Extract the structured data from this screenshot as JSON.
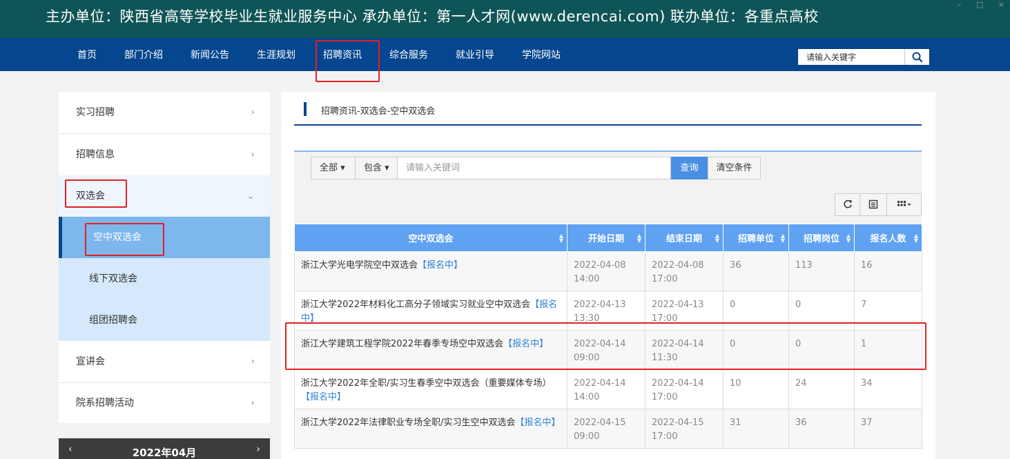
{
  "banner": {
    "text": "主办单位：陕西省高等学校毕业生就业服务中心   承办单位：第一人才网(www.derencai.com)   联办单位：各重点高校"
  },
  "window_controls": {
    "minimize": "–",
    "restore": "□",
    "close": "×"
  },
  "nav": {
    "items": [
      "首页",
      "部门介绍",
      "新闻公告",
      "生涯规划",
      "招聘资讯",
      "综合服务",
      "就业引导",
      "学院网站"
    ],
    "search_placeholder": "请输入关键字"
  },
  "sidebar": {
    "items": [
      {
        "label": "实习招聘",
        "arrow": "›"
      },
      {
        "label": "招聘信息",
        "arrow": "›"
      },
      {
        "label": "双选会",
        "arrow": "⌄"
      },
      {
        "label": "宣讲会",
        "arrow": "›"
      },
      {
        "label": "院系招聘活动",
        "arrow": "›"
      }
    ],
    "sub_items": [
      "空中双选会",
      "线下双选会",
      "组团招聘会"
    ]
  },
  "calendar": {
    "title": "2022年04月",
    "prev": "‹",
    "next": "›"
  },
  "content": {
    "breadcrumb": "招聘资讯-双选会-空中双选会",
    "filter": {
      "scope": "全部",
      "mode": "包含",
      "keyword_placeholder": "请输入关键词",
      "query_label": "查询",
      "clear_label": "清空条件"
    },
    "table": {
      "headers": [
        "空中双选会",
        "开始日期",
        "结束日期",
        "招聘单位",
        "招聘岗位",
        "报名人数"
      ],
      "status_label": "【报名中】",
      "rows": [
        {
          "name": "浙江大学光电学院空中双选会",
          "start": "2022-04-08 14:00",
          "end": "2022-04-08 17:00",
          "units": "36",
          "posts": "113",
          "applicants": "16"
        },
        {
          "name": "浙江大学2022年材料化工高分子领域实习就业空中双选会",
          "start": "2022-04-13 13:30",
          "end": "2022-04-13 17:00",
          "units": "0",
          "posts": "0",
          "applicants": "7"
        },
        {
          "name": "浙江大学建筑工程学院2022年春季专场空中双选会",
          "start": "2022-04-14 09:00",
          "end": "2022-04-14 11:30",
          "units": "0",
          "posts": "0",
          "applicants": "1"
        },
        {
          "name": "浙江大学2022年全职/实习生春季空中双选会（重要媒体专场）",
          "start": "2022-04-14 14:00",
          "end": "2022-04-14 17:00",
          "units": "10",
          "posts": "24",
          "applicants": "34"
        },
        {
          "name": "浙江大学2022年法律职业专场全职/实习生空中双选会",
          "start": "2022-04-15 09:00",
          "end": "2022-04-15 17:00",
          "units": "31",
          "posts": "36",
          "applicants": "37"
        }
      ]
    }
  },
  "colors": {
    "nav_bg": "#05468e",
    "banner_bg": "#0f5557",
    "header_bg": "#5fa2f1",
    "highlight": "#e02020",
    "link": "#2f82d8"
  }
}
